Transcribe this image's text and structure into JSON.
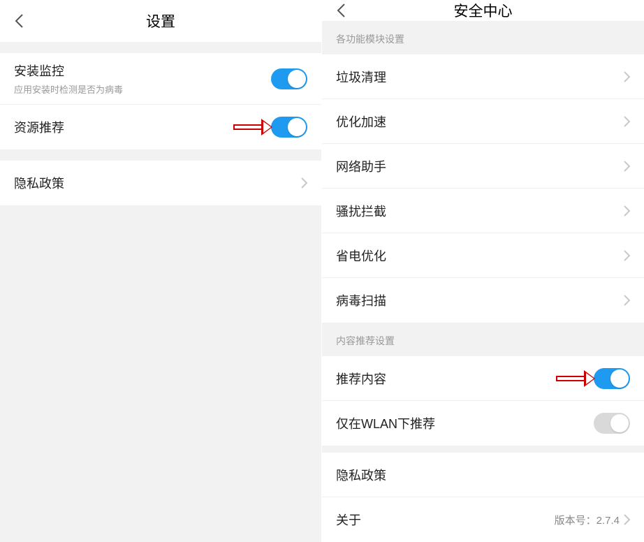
{
  "left": {
    "title": "设置",
    "rows": {
      "install_monitor": {
        "label": "安装监控",
        "sub": "应用安装时检测是否为病毒",
        "on": true
      },
      "resource_rec": {
        "label": "资源推荐",
        "on": true
      },
      "privacy": {
        "label": "隐私政策"
      }
    }
  },
  "right": {
    "title": "安全中心",
    "section1_header": "各功能模块设置",
    "section1": {
      "junk": {
        "label": "垃圾清理"
      },
      "boost": {
        "label": "优化加速"
      },
      "net": {
        "label": "网络助手"
      },
      "block": {
        "label": "骚扰拦截"
      },
      "power": {
        "label": "省电优化"
      },
      "virus": {
        "label": "病毒扫描"
      }
    },
    "section2_header": "内容推荐设置",
    "section2": {
      "rec_content": {
        "label": "推荐内容",
        "on": true
      },
      "wlan_only": {
        "label": "仅在WLAN下推荐",
        "on": false
      }
    },
    "section3": {
      "privacy": {
        "label": "隐私政策"
      },
      "about": {
        "label": "关于",
        "value": "版本号：2.7.4"
      }
    }
  }
}
